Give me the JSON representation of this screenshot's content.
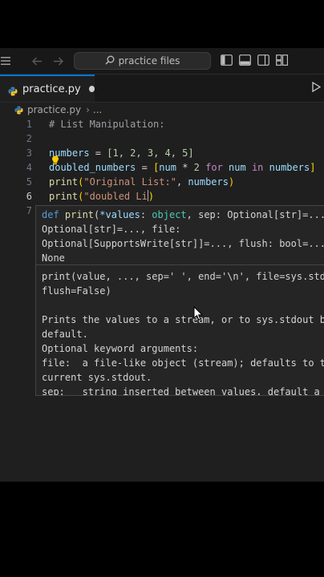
{
  "titlebar": {
    "search_placeholder": "practice files",
    "icons": [
      "menu-icon",
      "back-icon",
      "forward-icon",
      "search-icon",
      "toggle-sidebar-icon",
      "toggle-panel-icon",
      "toggle-secondary-sidebar-icon",
      "customize-layout-icon"
    ]
  },
  "tab": {
    "label": "practice.py"
  },
  "breadcrumb": {
    "file": "practice.py",
    "sep": "›",
    "more": "..."
  },
  "editor": {
    "line_numbers": [
      "1",
      "2",
      "3",
      "4",
      "5",
      "6",
      "7"
    ],
    "lines": {
      "l1": "# List Manipulation:",
      "l3_var": "numbers",
      "l3_rest": " = ",
      "l3_list": "[1, 2, 3, 4, 5]",
      "l4_var": "doubled_numbers",
      "l4_eq": " = ",
      "l4_open": "[",
      "l4_var2": "num",
      "l4_op": " * ",
      "l4_num": "2",
      "l4_for": " for ",
      "l4_var3": "num",
      "l4_in": " in ",
      "l4_var4": "numbers",
      "l4_close": "]",
      "l5_fn": "print",
      "l5_open": "(",
      "l5_str": "\"Original List:\"",
      "l5_mid": ", ",
      "l5_var": "numbers",
      "l5_close": ")",
      "l6_fn": "print",
      "l6_open": "(",
      "l6_str": "\"doubled Li",
      "l6_close": ")"
    }
  },
  "hover": {
    "sig1_def": "def ",
    "sig1_fn": "print",
    "sig1_rest_a": "(",
    "sig1_param": "*values",
    "sig1_rest_b": ": ",
    "sig1_type": "object",
    "sig1_rest_c": ", sep: Optional[str]=...",
    "sig2": "Optional[str]=..., file:",
    "sig3": "Optional[SupportsWrite[str]]=..., flush: bool=...",
    "sig4": "None",
    "doc1": "print(value, ..., sep=' ', end='\\n', file=sys.stdout,",
    "doc2": "flush=False)",
    "doc3": "Prints the values to a stream, or to sys.stdout by",
    "doc4": "default.",
    "doc5": "Optional keyword arguments:",
    "doc6": "file:  a file-like object (stream); defaults to the",
    "doc7": "current sys.stdout.",
    "doc8": "sep:   string inserted between values, default a space."
  },
  "colors": {
    "accent": "#0078d4",
    "editor_bg": "#1f1f1f",
    "chrome_bg": "#181818",
    "hover_bg": "#252526"
  }
}
